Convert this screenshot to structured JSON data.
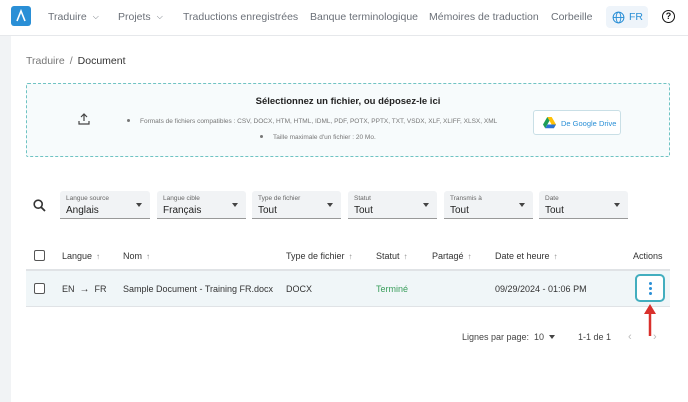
{
  "nav": {
    "items": [
      {
        "label": "Traduire",
        "has_dropdown": true
      },
      {
        "label": "Projets",
        "has_dropdown": true
      },
      {
        "label": "Traductions enregistrées",
        "has_dropdown": false
      },
      {
        "label": "Banque terminologique",
        "has_dropdown": false
      },
      {
        "label": "Mémoires de traduction",
        "has_dropdown": false
      },
      {
        "label": "Corbeille",
        "has_dropdown": false
      }
    ],
    "language": "FR",
    "help_icon": "help-circle-icon",
    "accent": "#2a8fd6"
  },
  "breadcrumb": {
    "parent": "Traduire",
    "separator": "/",
    "current": "Document"
  },
  "dropzone": {
    "title": "Sélectionnez un fichier, ou déposez-le ici",
    "formats": "Formats de fichiers compatibles : CSV, DOCX, HTM, HTML, IDML, PDF, POTX, PPTX, TXT, VSDX, XLF, XLIFF, XLSX, XML",
    "max_size": "Taille maximale d'un fichier : 20 Mo.",
    "google_drive_label": "De Google Drive",
    "border_color": "#6fc3c3"
  },
  "filters": [
    {
      "label": "Langue source",
      "value": "Anglais"
    },
    {
      "label": "Langue cible",
      "value": "Français"
    },
    {
      "label": "Type de fichier",
      "value": "Tout"
    },
    {
      "label": "Statut",
      "value": "Tout"
    },
    {
      "label": "Transmis à",
      "value": "Tout"
    },
    {
      "label": "Date",
      "value": "Tout"
    }
  ],
  "table": {
    "headers": {
      "langue": "Langue",
      "nom": "Nom",
      "type": "Type de fichier",
      "statut": "Statut",
      "partage": "Partagé",
      "date": "Date et heure",
      "actions": "Actions"
    },
    "rows": [
      {
        "source_lang": "EN",
        "target_lang": "FR",
        "name": "Sample Document - Training FR.docx",
        "type": "DOCX",
        "status": "Terminé",
        "shared": "",
        "datetime": "09/29/2024 - 01:06 PM"
      }
    ],
    "status_color": "#3a9e5c"
  },
  "pagination": {
    "rows_per_page_label": "Lignes par page:",
    "rows_per_page": "10",
    "range": "1-1 de 1"
  },
  "annotation": {
    "arrow_color": "#d9302c"
  }
}
